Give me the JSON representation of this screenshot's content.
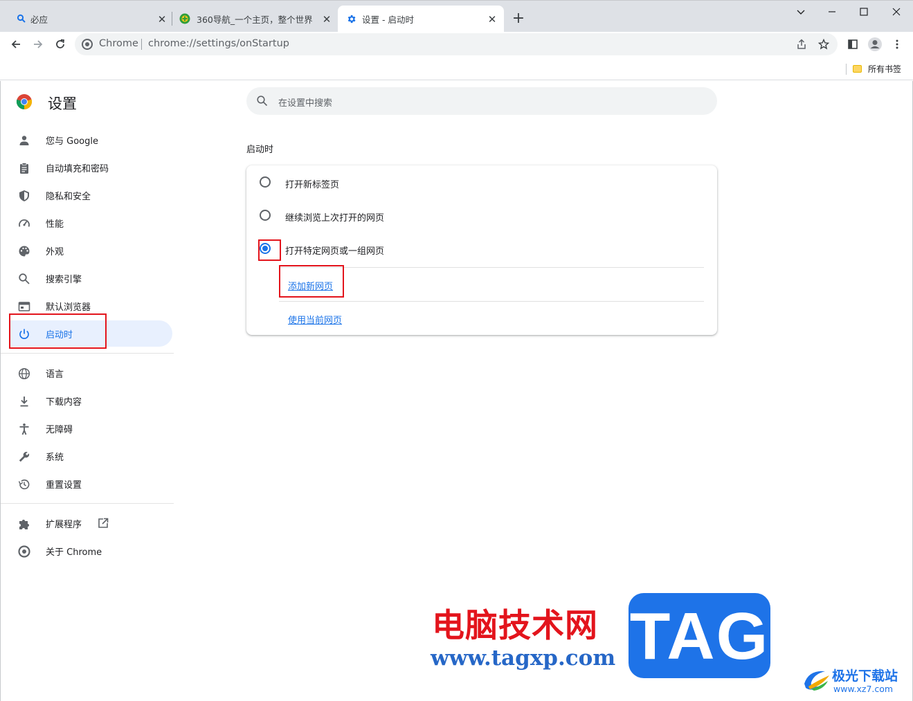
{
  "tabs": [
    {
      "title": "必应",
      "icon": "search-icon",
      "active": false
    },
    {
      "title": "360导航_一个主页，整个世界",
      "icon": "360-icon",
      "active": false
    },
    {
      "title": "设置 - 启动时",
      "icon": "gear-icon",
      "active": true
    }
  ],
  "omnibox": {
    "scheme_label": "Chrome",
    "url": "chrome://settings/onStartup"
  },
  "bookmarks": {
    "all_label": "所有书签"
  },
  "settings": {
    "title": "设置",
    "search_placeholder": "在设置中搜索",
    "sidebar": [
      {
        "label": "您与 Google",
        "icon": "person-icon"
      },
      {
        "label": "自动填充和密码",
        "icon": "clipboard-icon"
      },
      {
        "label": "隐私和安全",
        "icon": "shield-icon"
      },
      {
        "label": "性能",
        "icon": "speedometer-icon"
      },
      {
        "label": "外观",
        "icon": "palette-icon"
      },
      {
        "label": "搜索引擎",
        "icon": "search-icon"
      },
      {
        "label": "默认浏览器",
        "icon": "browser-window-icon"
      },
      {
        "label": "启动时",
        "icon": "power-icon",
        "selected": true
      },
      {
        "label": "语言",
        "icon": "globe-icon"
      },
      {
        "label": "下载内容",
        "icon": "download-icon"
      },
      {
        "label": "无障碍",
        "icon": "accessibility-icon"
      },
      {
        "label": "系统",
        "icon": "wrench-icon"
      },
      {
        "label": "重置设置",
        "icon": "history-icon"
      },
      {
        "label": "扩展程序",
        "icon": "puzzle-icon"
      },
      {
        "label": "关于 Chrome",
        "icon": "chrome-icon"
      }
    ],
    "section_title": "启动时",
    "options": [
      {
        "label": "打开新标签页",
        "checked": false
      },
      {
        "label": "继续浏览上次打开的网页",
        "checked": false
      },
      {
        "label": "打开特定网页或一组网页",
        "checked": true
      }
    ],
    "add_page_link": "添加新网页",
    "use_current_link": "使用当前网页"
  },
  "watermark": {
    "cn_text": "电脑技术网",
    "url": "www.tagxp.com",
    "tag": "TAG",
    "brand2": "极光下载站",
    "site2": "www.xz7.com"
  },
  "colors": {
    "accent": "#1a73e8",
    "highlight": "#e3141c",
    "tabstrip": "#dee1e6"
  }
}
